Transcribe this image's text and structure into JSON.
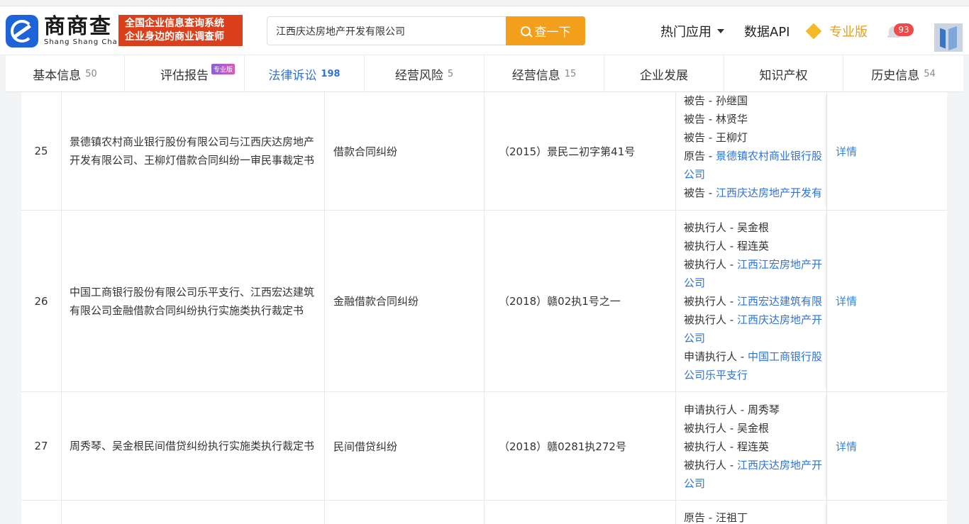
{
  "brand": {
    "name_cn": "商商查",
    "name_en": "Shang Shang Cha"
  },
  "slogan": {
    "line1": "全国企业信息查询系统",
    "line2": "企业身边的商业调查师"
  },
  "search": {
    "value": "江西庆达房地产开发有限公司",
    "button_label": "查一下"
  },
  "nav": {
    "hot_apps": "热门应用",
    "data_api": "数据API",
    "pro_version": "专业版",
    "notification_count": "93"
  },
  "tabs": [
    {
      "label": "基本信息",
      "count": "50"
    },
    {
      "label": "评估报告",
      "count": "",
      "tag": "专业版"
    },
    {
      "label": "法律诉讼",
      "count": "198",
      "active": true
    },
    {
      "label": "经营风险",
      "count": "5"
    },
    {
      "label": "经营信息",
      "count": "15"
    },
    {
      "label": "企业发展",
      "count": ""
    },
    {
      "label": "知识产权",
      "count": ""
    },
    {
      "label": "历史信息",
      "count": "54"
    }
  ],
  "rows": [
    {
      "no": "25",
      "title": "景德镇农村商业银行股份有限公司与江西庆达房地产开发有限公司、王柳灯借款合同纠纷一审民事裁定书",
      "cause": "借款合同纠纷",
      "case_no": "（2015）景民二初字第41号",
      "parties": [
        {
          "role": "被告 - ",
          "name": "孙继国"
        },
        {
          "role": "被告 - ",
          "name": "林贤华"
        },
        {
          "role": "被告 - ",
          "name": "王柳灯"
        },
        {
          "role": "原告 - ",
          "link": "景德镇农村商业银行股"
        },
        {
          "role": "",
          "link": "公司"
        },
        {
          "role": "被告 - ",
          "link": "江西庆达房地产开发有"
        }
      ],
      "action": "详情"
    },
    {
      "no": "26",
      "title": "中国工商银行股份有限公司乐平支行、江西宏达建筑有限公司金融借款合同纠纷执行实施类执行裁定书",
      "cause": "金融借款合同纠纷",
      "case_no": "（2018）赣02执1号之一",
      "parties": [
        {
          "role": "被执行人 - ",
          "name": "吴金根"
        },
        {
          "role": "被执行人 - ",
          "name": "程连英"
        },
        {
          "role": "被执行人 - ",
          "link": "江西江宏房地产开"
        },
        {
          "role": "",
          "link": "公司"
        },
        {
          "role": "被执行人 - ",
          "link": "江西宏达建筑有限"
        },
        {
          "role": "被执行人 - ",
          "link": "江西庆达房地产开"
        },
        {
          "role": "",
          "link": "公司"
        },
        {
          "role": "申请执行人 - ",
          "link": "中国工商银行股"
        },
        {
          "role": "",
          "link": "公司乐平支行"
        }
      ],
      "action": "详情"
    },
    {
      "no": "27",
      "title": "周秀琴、吴金根民间借贷纠纷执行实施类执行裁定书",
      "cause": "民间借贷纠纷",
      "case_no": "（2018）赣0281执272号",
      "parties": [
        {
          "role": "申请执行人 - ",
          "name": "周秀琴"
        },
        {
          "role": "被执行人 - ",
          "name": "吴金根"
        },
        {
          "role": "被执行人 - ",
          "name": "程连英"
        },
        {
          "role": "被执行人 - ",
          "link": "江西庆达房地产开"
        },
        {
          "role": "",
          "link": "公司"
        }
      ],
      "action": "详情"
    },
    {
      "no": "",
      "title": "",
      "cause": "",
      "case_no": "",
      "parties": [
        {
          "role": "原告 - ",
          "name": "汪祖丁"
        }
      ],
      "action": ""
    }
  ]
}
